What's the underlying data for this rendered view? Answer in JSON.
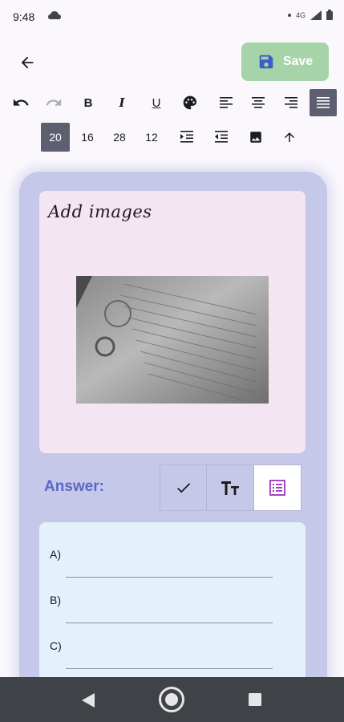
{
  "status": {
    "time": "9:48",
    "network": "4G"
  },
  "header": {
    "save_label": "Save"
  },
  "toolbar": {
    "format_items": [
      "undo-icon",
      "redo-icon",
      "bold",
      "italic",
      "underline",
      "palette-icon",
      "align-left-icon",
      "align-center-icon",
      "align-right-icon",
      "align-justify-icon"
    ],
    "bold_glyph": "B",
    "italic_glyph": "I",
    "underline_glyph": "U",
    "sizes": [
      "20",
      "16",
      "28",
      "12"
    ],
    "active_size": "20"
  },
  "question": {
    "text": "Add images"
  },
  "answer": {
    "label": "Answer:",
    "modes": [
      "check-icon",
      "text-size-icon",
      "list-icon"
    ],
    "active_mode": "list-icon",
    "options": [
      "A)",
      "B)",
      "C)"
    ]
  },
  "colors": {
    "accent": "#5b67c8",
    "save_bg": "#a6d4a8",
    "card_bg": "#c5c8e8",
    "question_bg": "#f4e5f3",
    "options_bg": "#e2f1fb",
    "toolbar_active": "#5d5f71"
  }
}
